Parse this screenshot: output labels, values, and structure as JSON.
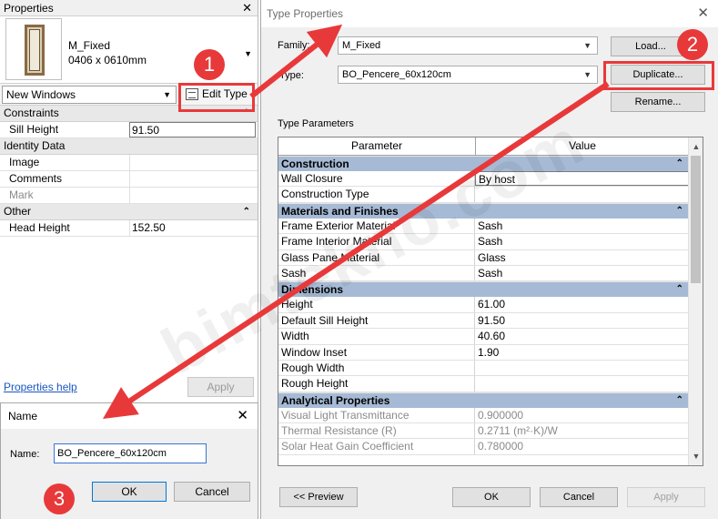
{
  "properties": {
    "title": "Properties",
    "close": "✕",
    "type_name": "M_Fixed",
    "type_size": "0406 x 0610mm",
    "category": "New Windows",
    "edit_type": "Edit Type",
    "sections": [
      {
        "name": "Constraints",
        "rows": [
          {
            "label": "Sill Height",
            "value": "91.50"
          }
        ]
      },
      {
        "name": "Identity Data",
        "rows": [
          {
            "label": "Image",
            "value": ""
          },
          {
            "label": "Comments",
            "value": ""
          },
          {
            "label": "Mark",
            "value": ""
          }
        ]
      },
      {
        "name": "Other",
        "rows": [
          {
            "label": "Head Height",
            "value": "152.50"
          }
        ]
      }
    ],
    "help_link": "Properties help",
    "apply": "Apply"
  },
  "name_dialog": {
    "title": "Name",
    "close": "✕",
    "label": "Name:",
    "value": "BO_Pencere_60x120cm",
    "ok": "OK",
    "cancel": "Cancel"
  },
  "type_properties": {
    "title": "Type Properties",
    "close": "✕",
    "family_label": "Family:",
    "family_value": "M_Fixed",
    "type_label": "Type:",
    "type_value": "BO_Pencere_60x120cm",
    "load": "Load...",
    "duplicate": "Duplicate...",
    "rename": "Rename...",
    "type_parameters": "Type Parameters",
    "col_parameter": "Parameter",
    "col_value": "Value",
    "groups": [
      {
        "name": "Construction",
        "rows": [
          {
            "p": "Wall Closure",
            "v": "By host"
          },
          {
            "p": "Construction Type",
            "v": ""
          }
        ]
      },
      {
        "name": "Materials and Finishes",
        "rows": [
          {
            "p": "Frame Exterior Material",
            "v": "Sash"
          },
          {
            "p": "Frame Interior Material",
            "v": "Sash"
          },
          {
            "p": "Glass Pane Material",
            "v": "Glass"
          },
          {
            "p": "Sash",
            "v": "Sash"
          }
        ]
      },
      {
        "name": "Dimensions",
        "rows": [
          {
            "p": "Height",
            "v": "61.00"
          },
          {
            "p": "Default Sill Height",
            "v": "91.50"
          },
          {
            "p": "Width",
            "v": "40.60"
          },
          {
            "p": "Window Inset",
            "v": "1.90"
          },
          {
            "p": "Rough Width",
            "v": ""
          },
          {
            "p": "Rough Height",
            "v": ""
          }
        ]
      },
      {
        "name": "Analytical Properties",
        "rows": [
          {
            "p": "Visual Light Transmittance",
            "v": "0.900000"
          },
          {
            "p": "Thermal Resistance (R)",
            "v": "0.2711 (m²·K)/W"
          },
          {
            "p": "Solar Heat Gain Coefficient",
            "v": "0.780000"
          }
        ]
      }
    ],
    "preview": "<< Preview",
    "ok": "OK",
    "cancel": "Cancel",
    "apply": "Apply"
  },
  "annotations": {
    "badges": [
      "1",
      "2",
      "3"
    ],
    "watermark": "bimtekno.com"
  },
  "colors": {
    "annotation": "#e8393a",
    "group_header": "#a6bad5",
    "link": "#1a58c0"
  }
}
